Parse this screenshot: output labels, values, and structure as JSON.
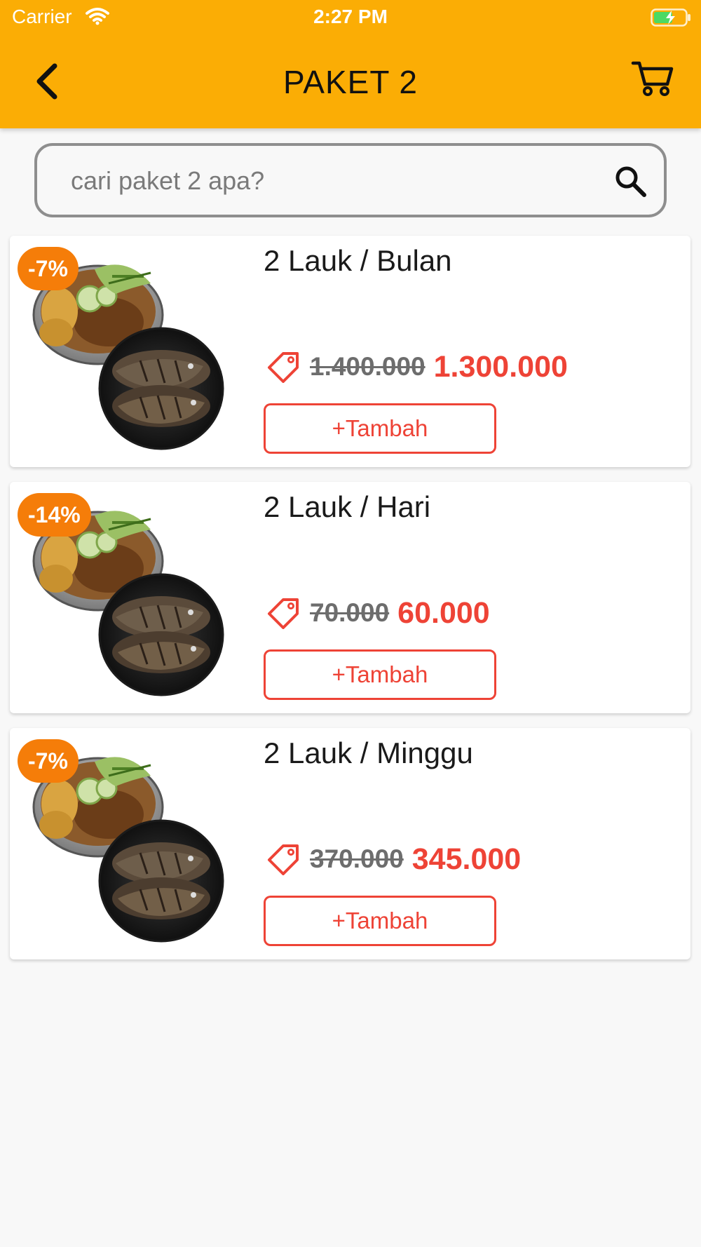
{
  "status_bar": {
    "carrier": "Carrier",
    "time": "2:27 PM"
  },
  "header": {
    "title": "PAKET 2",
    "back_icon": "chevron-left-icon",
    "cart_icon": "shopping-cart-icon",
    "background_color": "#fbad05"
  },
  "search": {
    "placeholder": "cari paket 2 apa?",
    "value": "",
    "icon": "search-icon"
  },
  "products": [
    {
      "discount": "-7%",
      "name": "2 Lauk / Bulan",
      "old_price": "1.400.000",
      "new_price": "1.300.000",
      "add_label": "+Tambah"
    },
    {
      "discount": "-14%",
      "name": "2 Lauk / Hari",
      "old_price": "70.000",
      "new_price": "60.000",
      "add_label": "+Tambah"
    },
    {
      "discount": "-7%",
      "name": "2 Lauk / Minggu",
      "old_price": "370.000",
      "new_price": "345.000",
      "add_label": "+Tambah"
    }
  ],
  "colors": {
    "accent": "#ee4336",
    "badge": "#f57d09"
  }
}
